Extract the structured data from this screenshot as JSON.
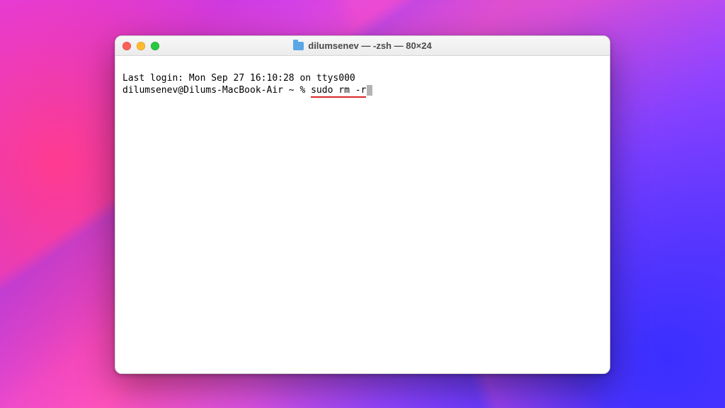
{
  "window": {
    "title": "dilumsenev — -zsh — 80×24"
  },
  "terminal": {
    "last_login": "Last login: Mon Sep 27 16:10:28 on ttys000",
    "prompt": "dilumsenev@Dilums-MacBook-Air ~ % ",
    "command": "sudo rm -r"
  }
}
